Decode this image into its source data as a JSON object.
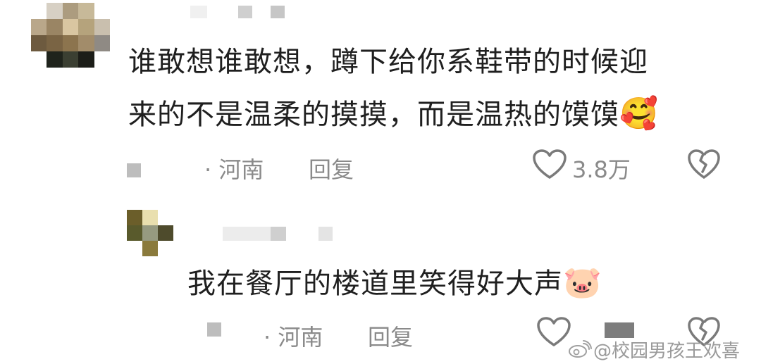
{
  "comments": [
    {
      "line1": "谁敢想谁敢想，蹲下给你系鞋带的时候迎",
      "line2": "来的不是温柔的摸摸，而是温热的馍馍",
      "emoji": "🥰",
      "location": "· 河南",
      "reply_label": "回复",
      "likes": "3.8万"
    },
    {
      "line1": "我在餐厅的楼道里笑得好大声",
      "emoji": "🐷",
      "location": "· 河南",
      "reply_label": "回复"
    }
  ],
  "watermark": "@校园男孩王欢喜",
  "icons": {
    "like": "heart-outline-icon",
    "dislike": "broken-heart-icon",
    "weibo": "weibo-logo-icon"
  },
  "colors": {
    "text": "#1f1f1f",
    "meta": "#8a8a8a",
    "icon": "#7a7a7a"
  }
}
